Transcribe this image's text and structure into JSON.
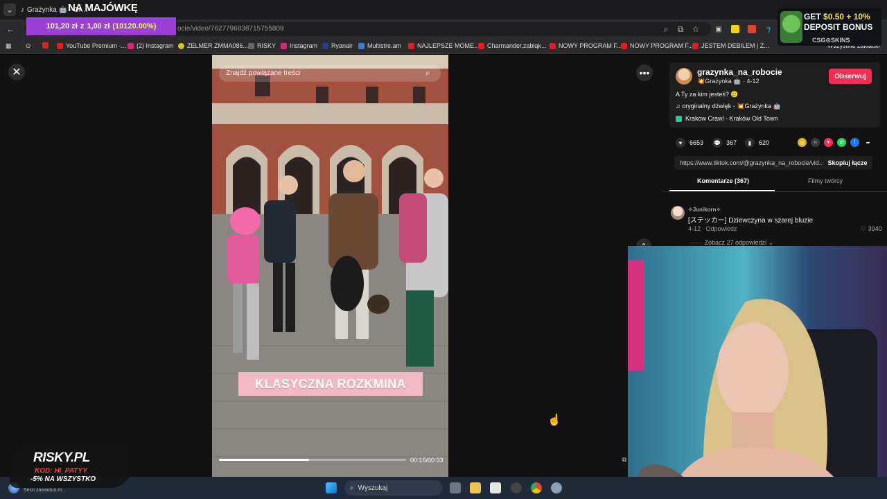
{
  "browser": {
    "tab_title": "Grażynka 🤖 - Gr…",
    "url": "ocie/video/7627796838715755809",
    "bookmarks": [
      "YouTube Premium -...",
      "(2) Instagram",
      "ZELMER ZMMA086...",
      "RISKY",
      "Instagram",
      "Ryanair",
      "Multistre.am",
      "NAJLEPSZE MOME...",
      "Charmander,zabłąk...",
      "NOWY PROGRAM F...",
      "NOWY PROGRAM F...",
      "JESTEM DEBILEM | Z...",
      "Wszystkie zakładki"
    ]
  },
  "promo": {
    "top_text": "NA MAJÓWKĘ",
    "amount": "101,20 zł",
    "mid": "z",
    "base": "1,00 zł",
    "percent": "(10120.00%)"
  },
  "deposit_ad": {
    "line1_pre": "GET",
    "line1_value": "$0.50 + 10%",
    "line2": "DEPOSIT BONUS",
    "brand": "CSG⊙SKINS"
  },
  "video": {
    "search_placeholder": "Znajdź powiązane treści",
    "caption": "KLASYCZNA ROZKMINA",
    "time": "00:16/00:33",
    "progress": 0.48
  },
  "post": {
    "author": "grazynka_na_robocie",
    "display_name": "💥Grażynka 🤖",
    "date": "4-12",
    "follow_label": "Obserwuj",
    "description": "A Ty za kim jesteś? 🥲",
    "sound": "oryginalny dźwięk - 💥Grażynka 🤖",
    "location": "Krakow Crawl - Kraków Old Town",
    "likes": "6653",
    "comments": "367",
    "saves": "620",
    "link": "https://www.tiktok.com/@grazynka_na_robocie/vid...",
    "copy_label": "Skopiuj łącze"
  },
  "tabs": {
    "comments": "Komentarze (367)",
    "creator": "Filmy twórcy"
  },
  "comment": {
    "user": "✧Junikorn✧",
    "text": "[ステッカー] Dziewczyna w szarej bluzie",
    "date": "4-12",
    "reply": "Odpowiedz",
    "likes": "3940",
    "view_replies": "Zobacz 27 odpowiedzi"
  },
  "taskbar": {
    "search": "Wyszukaj",
    "weather": "Sexri zawiaduó m..."
  },
  "risky": {
    "logo": "RISKY.PL",
    "code": "KOD: HI_PATYY",
    "discount": "-5% NA WSZYSTKO"
  },
  "colors": {
    "follow": "#fe2c55",
    "promo": "#9b3fd6",
    "caption_bg": "#f2b8c6"
  }
}
